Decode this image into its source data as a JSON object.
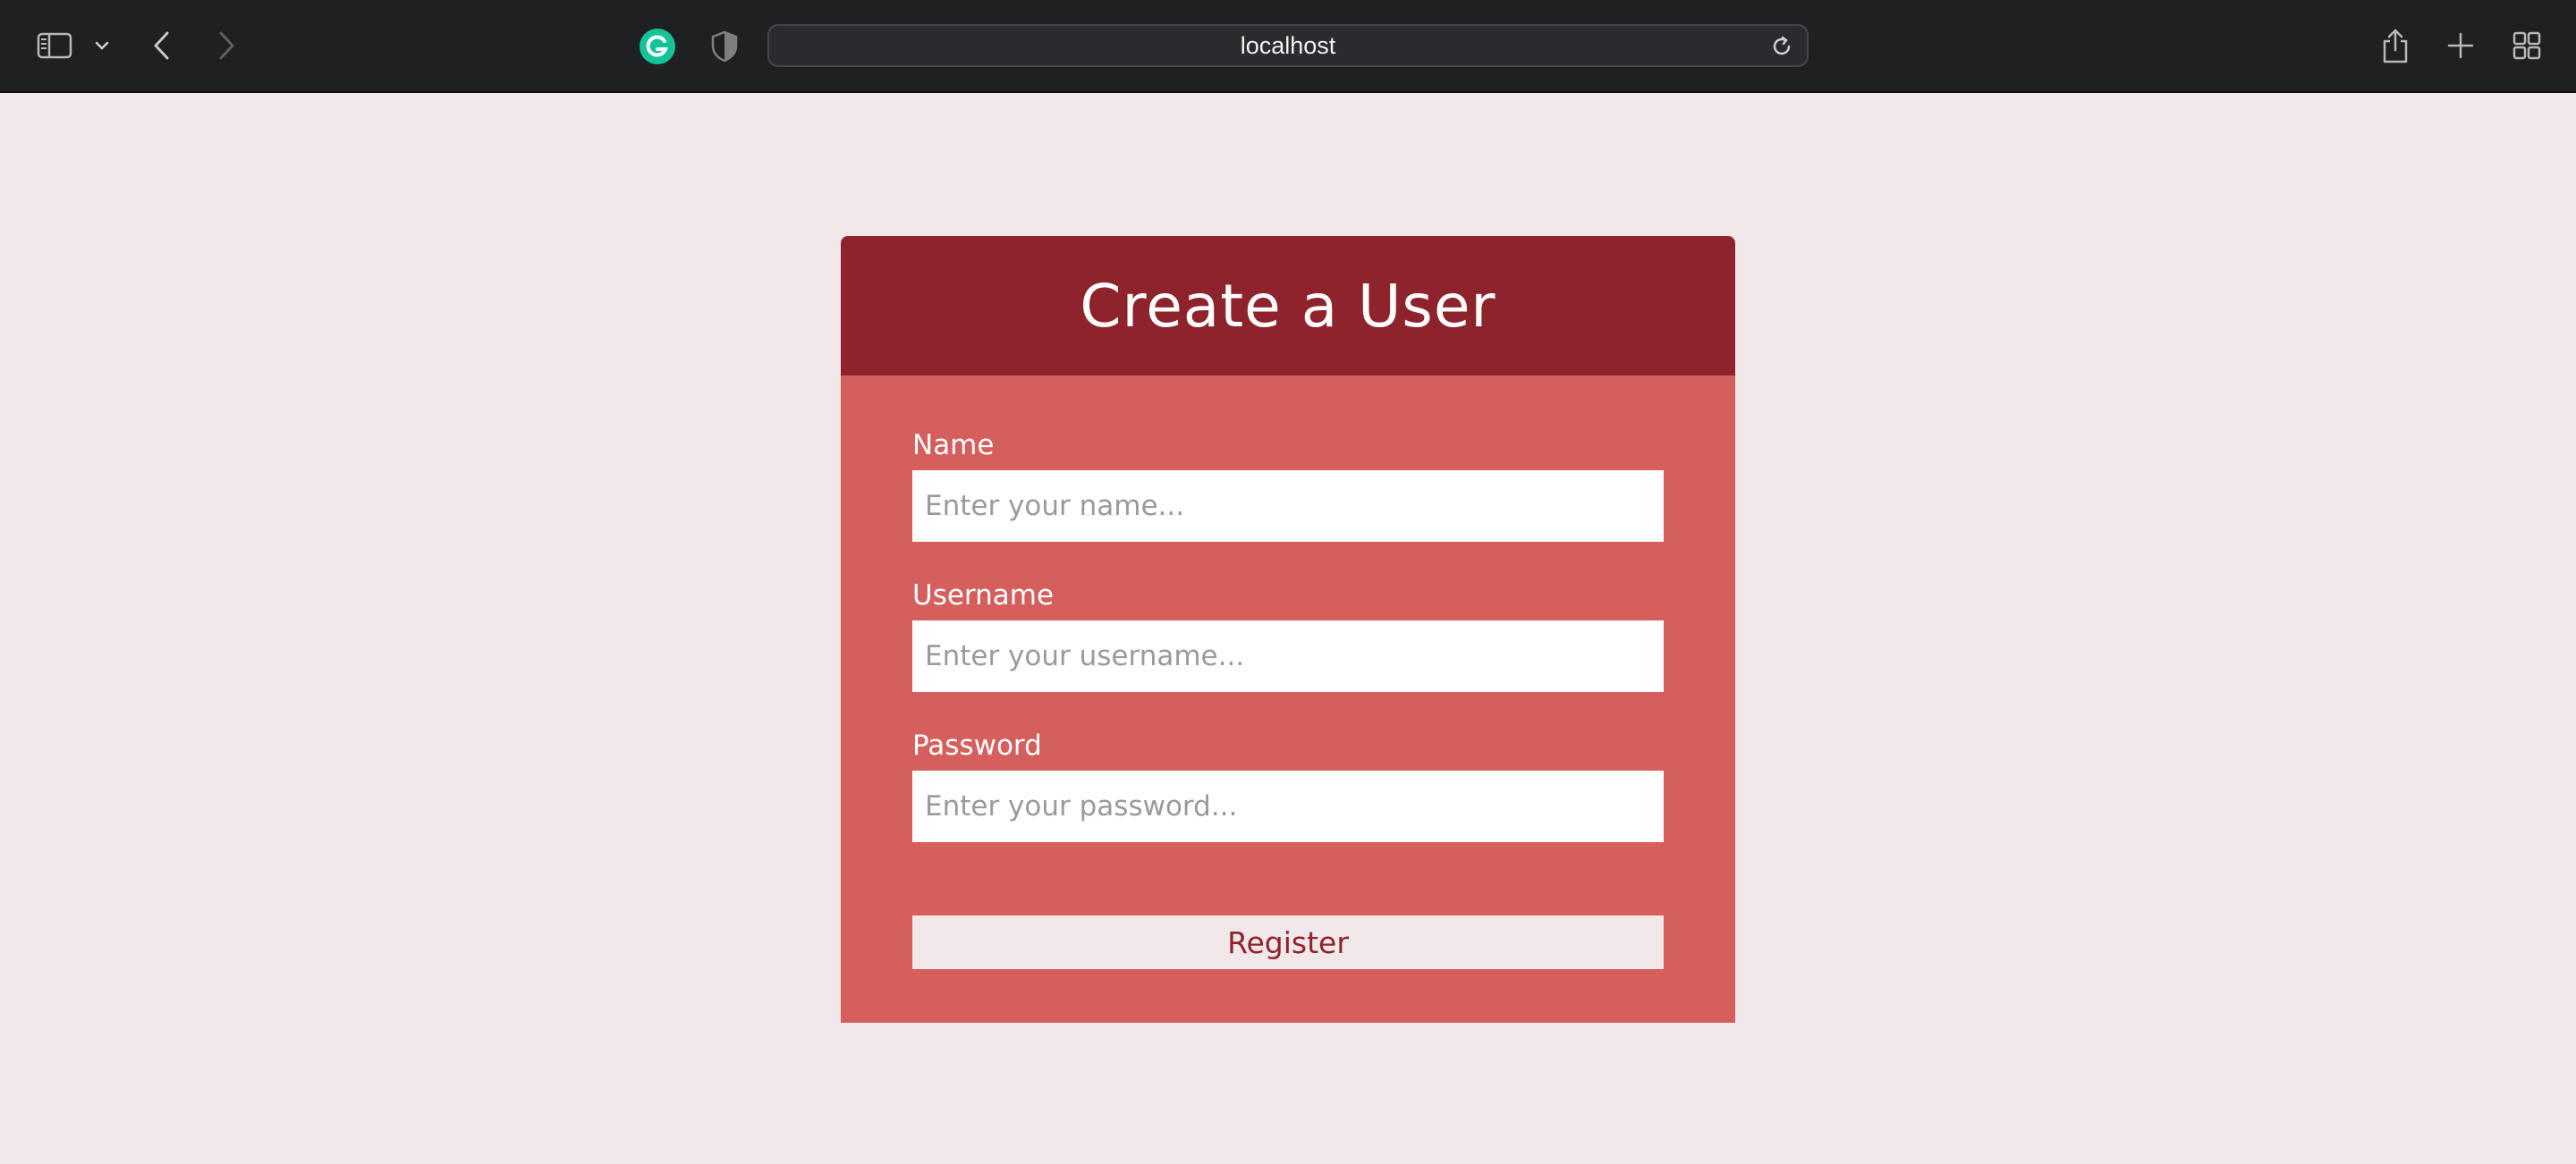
{
  "browser": {
    "address": "localhost",
    "icons": {
      "sidebar": "sidebar-icon",
      "sidebar_menu": "chevron-down-icon",
      "back": "chevron-left-icon",
      "forward": "chevron-right-icon",
      "extension": "grammarly-icon",
      "privacy": "shield-icon",
      "reload": "reload-icon",
      "share": "share-icon",
      "new_tab": "plus-icon",
      "tab_overview": "grid-icon"
    }
  },
  "form": {
    "title": "Create a User",
    "fields": [
      {
        "label": "Name",
        "placeholder": "Enter your name...",
        "value": ""
      },
      {
        "label": "Username",
        "placeholder": "Enter your username...",
        "value": ""
      },
      {
        "label": "Password",
        "placeholder": "Enter your password...",
        "value": ""
      }
    ],
    "submit_label": "Register"
  },
  "colors": {
    "page_background": "#f2e7e9",
    "header_background": "#8f232b",
    "form_background": "#d45f5c",
    "button_text": "#8f232b",
    "toolbar_background": "#1f2022",
    "grammarly_green": "#15c39a"
  }
}
